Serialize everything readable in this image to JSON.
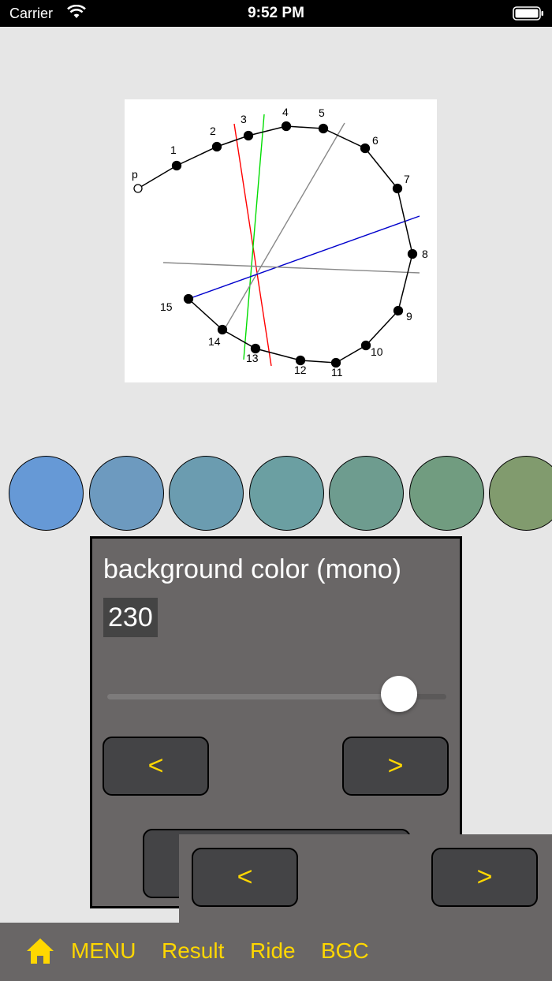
{
  "status_bar": {
    "carrier": "Carrier",
    "time": "9:52 PM"
  },
  "diagram": {
    "points": [
      {
        "label": "p"
      },
      {
        "label": "1"
      },
      {
        "label": "2"
      },
      {
        "label": "3"
      },
      {
        "label": "4"
      },
      {
        "label": "5"
      },
      {
        "label": "6"
      },
      {
        "label": "7"
      },
      {
        "label": "8"
      },
      {
        "label": "9"
      },
      {
        "label": "10"
      },
      {
        "label": "11"
      },
      {
        "label": "12"
      },
      {
        "label": "13"
      },
      {
        "label": "14"
      },
      {
        "label": "15"
      }
    ],
    "line_colors": [
      "#ff0000",
      "#00dd00",
      "#888888",
      "#0000cc",
      "#888888"
    ]
  },
  "swatches": [
    "#6699d6",
    "#6d9abf",
    "#6b9cb0",
    "#6b9fa2",
    "#6e9c8f",
    "#719c80",
    "#819b6e"
  ],
  "panel": {
    "title": "background color (mono)",
    "value": "230",
    "slider_fraction": 0.86,
    "prev_label": "<",
    "next_label": ">"
  },
  "overlay": {
    "prev_label": "<",
    "next_label": ">"
  },
  "nav": {
    "home_icon": "home-icon",
    "menu": "MENU",
    "result": "Result",
    "ride": "Ride",
    "bgc": "BGC"
  },
  "colors": {
    "accent": "#ffd700",
    "panel_bg": "#696666",
    "page_bg": "#e6e6e6"
  }
}
